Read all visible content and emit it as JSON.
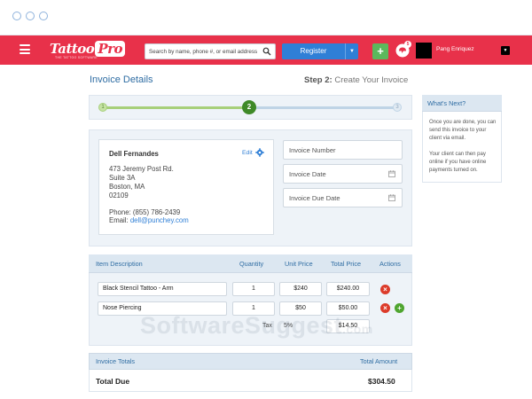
{
  "brand": {
    "name_a": "Tattoo",
    "name_b": "Pro",
    "tagline": "THE TATTOO SOFTWARE"
  },
  "header": {
    "search_placeholder": "Search by name, phone #, or email address",
    "register_label": "Register",
    "add_label": "+",
    "notification_count": "5",
    "user_name": "Pang Enriquez"
  },
  "page": {
    "title": "Invoice Details",
    "step_prefix": "Step 2:",
    "step_name": "Create Your Invoice"
  },
  "stepper": {
    "steps": [
      "1",
      "2",
      "3"
    ],
    "current": 2
  },
  "client": {
    "name": "Dell Fernandes",
    "edit_label": "Edit",
    "address": [
      "473 Jeremy Post Rd.",
      "Suite 3A",
      "Boston, MA",
      "02109"
    ],
    "phone_label": "Phone:",
    "phone": "(855) 786-2439",
    "email_label": "Email:",
    "email": "dell@punchey.com"
  },
  "fields": {
    "invoice_number": "Invoice Number",
    "invoice_date": "Invoice Date",
    "due_date": "Invoice Due Date"
  },
  "items": {
    "headers": {
      "description": "Item Description",
      "quantity": "Quantity",
      "unit_price": "Unit Price",
      "total_price": "Total Price",
      "actions": "Actions"
    },
    "rows": [
      {
        "description": "Black Stencil Tattoo - Arm",
        "quantity": "1",
        "unit_price": "$240",
        "total": "$240.00"
      },
      {
        "description": "Nose Piercing",
        "quantity": "1",
        "unit_price": "$50",
        "total": "$50.00"
      }
    ],
    "tax_label": "Tax",
    "tax_rate": "5%",
    "tax_amount": "$14.50"
  },
  "totals": {
    "label": "Invoice Totals",
    "amount_header": "Total Amount",
    "due_label": "Total Due",
    "due_amount": "$304.50"
  },
  "sidebar": {
    "title": "What's Next?",
    "paragraph1": "Once you are done, you can send this invoice to your client via email.",
    "paragraph2": "Your client can then pay online if you have online payments turned on."
  },
  "watermark": {
    "text": "SoftwareSuggest",
    "suffix": ".com"
  },
  "colors": {
    "brand": "#e8314a",
    "primary": "#2f7fd6",
    "success": "#4fa52f",
    "danger": "#dc3b2a",
    "header_text": "#2f6da3"
  }
}
